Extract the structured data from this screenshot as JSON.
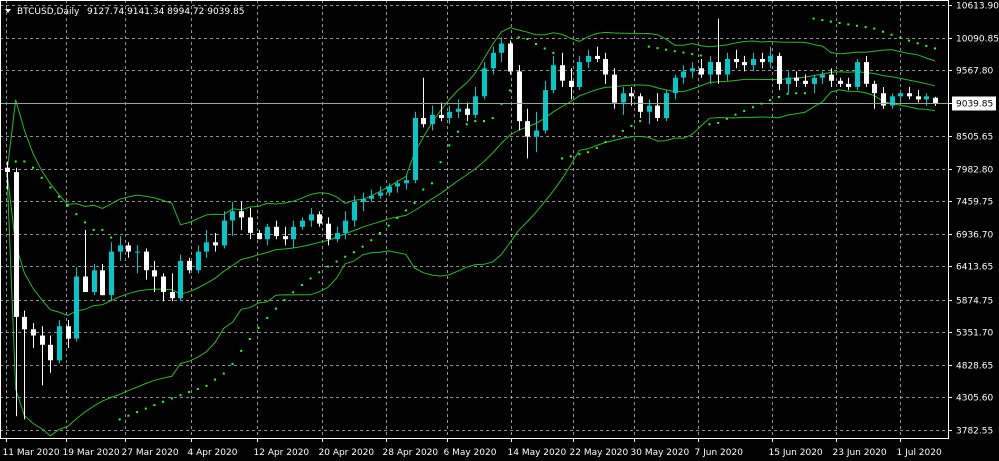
{
  "header": {
    "symbol": "BTCUSD,Daily",
    "ohlc": "9127.74 9141.34 8994.72 9039.85"
  },
  "colors": {
    "background": "#000000",
    "frame": "#ffffff",
    "grid": "#c0c0c0",
    "bull": "#00c8c8",
    "bear": "#ffffff",
    "bands": "#2fb82f",
    "psar": "#33ff33",
    "price_line": "#8fa88f"
  },
  "chart_data": {
    "type": "candlestick",
    "symbol": "BTCUSD",
    "timeframe": "Daily",
    "ylim": [
      3650,
      10700
    ],
    "y_ticks": [
      "10613.90",
      "10090.85",
      "9567.80",
      "9039.85",
      "8505.65",
      "7982.80",
      "7459.75",
      "6936.70",
      "6413.65",
      "5874.75",
      "5351.70",
      "4828.65",
      "4305.60",
      "3782.55"
    ],
    "x_ticks": [
      "11 Mar 2020",
      "19 Mar 2020",
      "27 Mar 2020",
      "4 Apr 2020",
      "12 Apr 2020",
      "20 Apr 2020",
      "28 Apr 2020",
      "6 May 2020",
      "14 May 2020",
      "22 May 2020",
      "30 May 2020",
      "7 Jun 2020",
      "15 Jun 2020",
      "23 Jun 2020",
      "1 Jul 2020"
    ],
    "last_price": "9039.85",
    "grid": true,
    "candles": [
      {
        "o": 8000,
        "h": 8100,
        "l": 7650,
        "c": 7930
      },
      {
        "o": 7930,
        "h": 8000,
        "l": 4000,
        "c": 5600
      },
      {
        "o": 5600,
        "h": 5700,
        "l": 3950,
        "c": 5400
      },
      {
        "o": 5400,
        "h": 5500,
        "l": 5100,
        "c": 5300
      },
      {
        "o": 5300,
        "h": 5450,
        "l": 4500,
        "c": 5150
      },
      {
        "o": 5150,
        "h": 5300,
        "l": 4700,
        "c": 4900
      },
      {
        "o": 4900,
        "h": 5550,
        "l": 4850,
        "c": 5450
      },
      {
        "o": 5450,
        "h": 5550,
        "l": 5100,
        "c": 5250
      },
      {
        "o": 5250,
        "h": 6400,
        "l": 5200,
        "c": 6250
      },
      {
        "o": 6250,
        "h": 7000,
        "l": 6000,
        "c": 6000
      },
      {
        "o": 6000,
        "h": 6450,
        "l": 5950,
        "c": 6350
      },
      {
        "o": 6350,
        "h": 6450,
        "l": 5950,
        "c": 5950
      },
      {
        "o": 5950,
        "h": 6800,
        "l": 5850,
        "c": 6650
      },
      {
        "o": 6650,
        "h": 6900,
        "l": 6500,
        "c": 6750
      },
      {
        "o": 6750,
        "h": 6800,
        "l": 6550,
        "c": 6650
      },
      {
        "o": 6650,
        "h": 6750,
        "l": 6300,
        "c": 6650
      },
      {
        "o": 6650,
        "h": 6700,
        "l": 6200,
        "c": 6350
      },
      {
        "o": 6350,
        "h": 6500,
        "l": 6000,
        "c": 6250
      },
      {
        "o": 6250,
        "h": 6300,
        "l": 5850,
        "c": 6000
      },
      {
        "o": 6000,
        "h": 6300,
        "l": 5850,
        "c": 5900
      },
      {
        "o": 5900,
        "h": 6600,
        "l": 5850,
        "c": 6500
      },
      {
        "o": 6500,
        "h": 6550,
        "l": 6300,
        "c": 6350
      },
      {
        "o": 6350,
        "h": 6750,
        "l": 6300,
        "c": 6650
      },
      {
        "o": 6650,
        "h": 7000,
        "l": 6550,
        "c": 6800
      },
      {
        "o": 6800,
        "h": 6950,
        "l": 6650,
        "c": 6750
      },
      {
        "o": 6750,
        "h": 7300,
        "l": 6700,
        "c": 7150
      },
      {
        "o": 7150,
        "h": 7450,
        "l": 6900,
        "c": 7300
      },
      {
        "o": 7300,
        "h": 7450,
        "l": 7000,
        "c": 7200
      },
      {
        "o": 7200,
        "h": 7350,
        "l": 6850,
        "c": 6950
      },
      {
        "o": 6950,
        "h": 7000,
        "l": 6850,
        "c": 6850
      },
      {
        "o": 6850,
        "h": 7100,
        "l": 6750,
        "c": 7050
      },
      {
        "o": 7050,
        "h": 7150,
        "l": 6850,
        "c": 6900
      },
      {
        "o": 6900,
        "h": 7050,
        "l": 6750,
        "c": 6850
      },
      {
        "o": 6850,
        "h": 7150,
        "l": 6700,
        "c": 7050
      },
      {
        "o": 7050,
        "h": 7200,
        "l": 7000,
        "c": 7150
      },
      {
        "o": 7150,
        "h": 7350,
        "l": 7050,
        "c": 7250
      },
      {
        "o": 7250,
        "h": 7300,
        "l": 7050,
        "c": 7100
      },
      {
        "o": 7100,
        "h": 7200,
        "l": 6750,
        "c": 6850
      },
      {
        "o": 6850,
        "h": 7050,
        "l": 6800,
        "c": 6950
      },
      {
        "o": 6950,
        "h": 7300,
        "l": 6850,
        "c": 7150
      },
      {
        "o": 7150,
        "h": 7550,
        "l": 7050,
        "c": 7450
      },
      {
        "o": 7450,
        "h": 7600,
        "l": 7300,
        "c": 7500
      },
      {
        "o": 7500,
        "h": 7650,
        "l": 7450,
        "c": 7550
      },
      {
        "o": 7550,
        "h": 7700,
        "l": 7500,
        "c": 7600
      },
      {
        "o": 7600,
        "h": 7750,
        "l": 7550,
        "c": 7700
      },
      {
        "o": 7700,
        "h": 7800,
        "l": 7600,
        "c": 7750
      },
      {
        "o": 7750,
        "h": 7900,
        "l": 7650,
        "c": 7800
      },
      {
        "o": 7800,
        "h": 8900,
        "l": 7750,
        "c": 8800
      },
      {
        "o": 8800,
        "h": 9450,
        "l": 8650,
        "c": 8700
      },
      {
        "o": 8700,
        "h": 9000,
        "l": 8600,
        "c": 8850
      },
      {
        "o": 8850,
        "h": 9050,
        "l": 8750,
        "c": 8800
      },
      {
        "o": 8800,
        "h": 9000,
        "l": 8700,
        "c": 8900
      },
      {
        "o": 8900,
        "h": 9100,
        "l": 8800,
        "c": 8950
      },
      {
        "o": 8950,
        "h": 9050,
        "l": 8750,
        "c": 8850
      },
      {
        "o": 8850,
        "h": 9300,
        "l": 8800,
        "c": 9150
      },
      {
        "o": 9150,
        "h": 9700,
        "l": 9100,
        "c": 9600
      },
      {
        "o": 9600,
        "h": 9950,
        "l": 9500,
        "c": 9850
      },
      {
        "o": 9850,
        "h": 10100,
        "l": 9700,
        "c": 10000
      },
      {
        "o": 10000,
        "h": 10050,
        "l": 9500,
        "c": 9550
      },
      {
        "o": 9550,
        "h": 9650,
        "l": 8600,
        "c": 8750
      },
      {
        "o": 8750,
        "h": 8950,
        "l": 8150,
        "c": 8500
      },
      {
        "o": 8500,
        "h": 8900,
        "l": 8250,
        "c": 8600
      },
      {
        "o": 8600,
        "h": 9400,
        "l": 8550,
        "c": 9250
      },
      {
        "o": 9250,
        "h": 9800,
        "l": 9200,
        "c": 9650
      },
      {
        "o": 9650,
        "h": 9850,
        "l": 9300,
        "c": 9400
      },
      {
        "o": 9400,
        "h": 9600,
        "l": 9100,
        "c": 9300
      },
      {
        "o": 9300,
        "h": 9800,
        "l": 9250,
        "c": 9700
      },
      {
        "o": 9700,
        "h": 9900,
        "l": 9600,
        "c": 9800
      },
      {
        "o": 9800,
        "h": 9950,
        "l": 9700,
        "c": 9750
      },
      {
        "o": 9750,
        "h": 9850,
        "l": 9350,
        "c": 9500
      },
      {
        "o": 9500,
        "h": 9600,
        "l": 8950,
        "c": 9050
      },
      {
        "o": 9050,
        "h": 9300,
        "l": 8850,
        "c": 9200
      },
      {
        "o": 9200,
        "h": 9300,
        "l": 9000,
        "c": 9150
      },
      {
        "o": 9150,
        "h": 9200,
        "l": 8800,
        "c": 8900
      },
      {
        "o": 8900,
        "h": 9100,
        "l": 8700,
        "c": 9000
      },
      {
        "o": 9000,
        "h": 9200,
        "l": 8750,
        "c": 8800
      },
      {
        "o": 8800,
        "h": 9250,
        "l": 8750,
        "c": 9200
      },
      {
        "o": 9200,
        "h": 9500,
        "l": 9100,
        "c": 9450
      },
      {
        "o": 9450,
        "h": 9650,
        "l": 9350,
        "c": 9550
      },
      {
        "o": 9550,
        "h": 9700,
        "l": 9450,
        "c": 9600
      },
      {
        "o": 9600,
        "h": 9750,
        "l": 9450,
        "c": 9500
      },
      {
        "o": 9500,
        "h": 9800,
        "l": 9350,
        "c": 9700
      },
      {
        "o": 9700,
        "h": 10400,
        "l": 9350,
        "c": 9500
      },
      {
        "o": 9500,
        "h": 9850,
        "l": 9400,
        "c": 9750
      },
      {
        "o": 9750,
        "h": 9900,
        "l": 9600,
        "c": 9700
      },
      {
        "o": 9700,
        "h": 9800,
        "l": 9550,
        "c": 9650
      },
      {
        "o": 9650,
        "h": 9850,
        "l": 9550,
        "c": 9750
      },
      {
        "o": 9750,
        "h": 9850,
        "l": 9600,
        "c": 9700
      },
      {
        "o": 9700,
        "h": 9950,
        "l": 9600,
        "c": 9800
      },
      {
        "o": 9800,
        "h": 9850,
        "l": 9250,
        "c": 9350
      },
      {
        "o": 9350,
        "h": 9550,
        "l": 9200,
        "c": 9450
      },
      {
        "o": 9450,
        "h": 9550,
        "l": 9300,
        "c": 9400
      },
      {
        "o": 9400,
        "h": 9500,
        "l": 9300,
        "c": 9350
      },
      {
        "o": 9350,
        "h": 9500,
        "l": 9200,
        "c": 9450
      },
      {
        "o": 9450,
        "h": 9550,
        "l": 9350,
        "c": 9500
      },
      {
        "o": 9500,
        "h": 9600,
        "l": 9300,
        "c": 9400
      },
      {
        "o": 9400,
        "h": 9450,
        "l": 9300,
        "c": 9350
      },
      {
        "o": 9350,
        "h": 9450,
        "l": 9250,
        "c": 9300
      },
      {
        "o": 9300,
        "h": 9750,
        "l": 9250,
        "c": 9700
      },
      {
        "o": 9700,
        "h": 9800,
        "l": 9300,
        "c": 9350
      },
      {
        "o": 9350,
        "h": 9400,
        "l": 8950,
        "c": 9200
      },
      {
        "o": 9200,
        "h": 9300,
        "l": 8950,
        "c": 9000
      },
      {
        "o": 9000,
        "h": 9200,
        "l": 8950,
        "c": 9150
      },
      {
        "o": 9150,
        "h": 9250,
        "l": 9050,
        "c": 9200
      },
      {
        "o": 9200,
        "h": 9300,
        "l": 9100,
        "c": 9150
      },
      {
        "o": 9150,
        "h": 9250,
        "l": 9050,
        "c": 9100
      },
      {
        "o": 9100,
        "h": 9200,
        "l": 9000,
        "c": 9150
      },
      {
        "o": 9127.74,
        "h": 9141.34,
        "l": 8994.72,
        "c": 9039.85
      }
    ]
  }
}
